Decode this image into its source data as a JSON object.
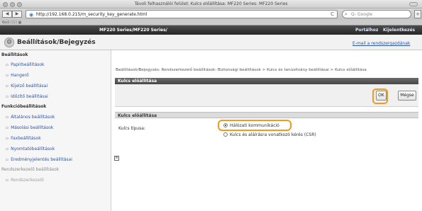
{
  "window": {
    "title": "Távoli felhasználói felület: Kulcs előállítása: MF220 Series: MF220 Series"
  },
  "toolbar": {
    "url": "http://192.168.0.215/m_security_key_generate.html",
    "search_placeholder": "Q- Google",
    "back_label": "◀",
    "forward_label": "▶",
    "add_label": "+",
    "reload_label": "C"
  },
  "bookmarks": {
    "label": "6o⊡ ☐☐ ▦"
  },
  "header": {
    "series_title": "MF220 Series/MF220 Series/",
    "portal_link": "Portálhoz",
    "logout_link": "Kijelentkezés"
  },
  "subheader": {
    "page_title": "Beállítások/Bejegyzés",
    "email_link": "E-mail a rendszergazdának"
  },
  "sidebar": {
    "sections": [
      {
        "title": "Beállítások",
        "items": [
          "Papírbeállítások",
          "Hangerő",
          "Kijelző beállításai",
          "Időzítő beállításai"
        ]
      },
      {
        "title": "Funkcióbeállítások",
        "items": [
          "Általános beállítások",
          "Másolási beállítások",
          "Faxbeállítások",
          "Nyomtatóbeállítások",
          "Eredményjelentés beállításai"
        ]
      },
      {
        "title": "Rendszerkezelő beállítások",
        "items": [
          "Rendszerkezelő"
        ]
      }
    ]
  },
  "main": {
    "breadcrumb": "Beállítások/Bejegyzés: Rendszerkezelő beállítások: Biztonsági beállítások > Kulcs és tanúsítvány beállításai > Kulcs előállítása",
    "panel_title": "Kulcs előállítása",
    "ok_label": "OK",
    "cancel_label": "Mégse",
    "section_title": "Kulcs előállítása",
    "key_type_label": "Kulcs típusa:",
    "options": [
      {
        "label": "Hálózati kommunikáció",
        "checked": true
      },
      {
        "label": "Kulcs és aláírásra vonatkozó kérés (CSR)",
        "checked": false
      }
    ]
  },
  "colors": {
    "highlight": "#f39a1c",
    "header_bg": "#2e2e2e",
    "link": "#2f56a0"
  }
}
